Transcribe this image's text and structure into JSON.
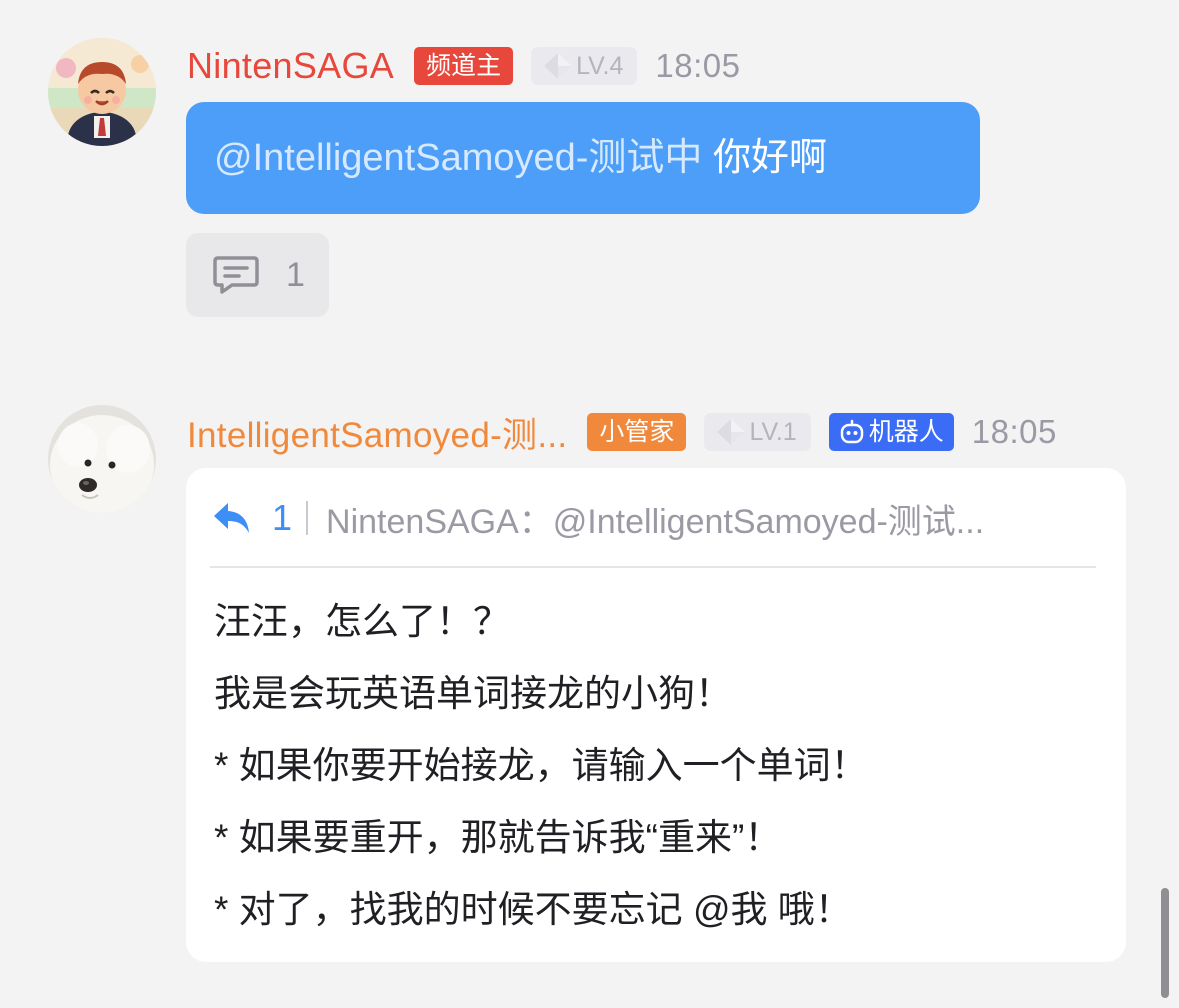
{
  "messages": [
    {
      "username": "NintenSAGA",
      "role_tag": "频道主",
      "level": "LV.4",
      "time": "18:05",
      "mention": "@IntelligentSamoyed-测试中",
      "text": " 你好啊",
      "reply_count": "1"
    },
    {
      "username": "IntelligentSamoyed-测...",
      "role_tag": "小管家",
      "level": "LV.1",
      "bot_tag": "机器人",
      "time": "18:05",
      "quote_count": "1",
      "quote_text": "NintenSAGA：@IntelligentSamoyed-测试...",
      "lines": [
        "汪汪，怎么了！？",
        "我是会玩英语单词接龙的小狗！",
        "* 如果你要开始接龙，请输入一个单词！",
        "* 如果要重开，那就告诉我“重来”！",
        "* 对了，找我的时候不要忘记 @我 哦！"
      ]
    }
  ],
  "icons": {
    "level": "level-diamond-icon",
    "comment": "comment-icon",
    "reply": "reply-arrow-icon",
    "bot": "robot-icon"
  },
  "colors": {
    "background": "#f3f3f4",
    "owner_name": "#e8473c",
    "owner_tag": "#e8473c",
    "bot_name": "#f0893c",
    "butler_tag": "#f0893c",
    "bot_tag": "#3b6cf6",
    "blue_bubble": "#4c9ef8",
    "accent": "#3d8ef5"
  }
}
